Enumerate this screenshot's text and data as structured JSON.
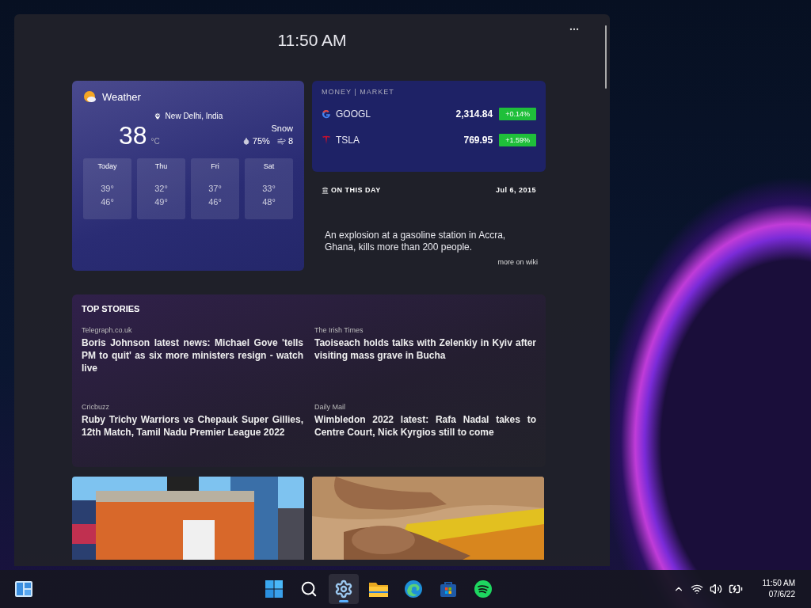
{
  "clock": "11:50 AM",
  "weather": {
    "title": "Weather",
    "location": "New Delhi, India",
    "temperature": "38",
    "unit": "°C",
    "condition": "Snow",
    "humidity": "75%",
    "wind": "8",
    "forecast": [
      {
        "day": "Today",
        "high": "39°",
        "low": "46°"
      },
      {
        "day": "Thu",
        "high": "32°",
        "low": "49°"
      },
      {
        "day": "Fri",
        "high": "37°",
        "low": "46°"
      },
      {
        "day": "Sat",
        "high": "33°",
        "low": "48°"
      }
    ]
  },
  "market": {
    "title": "MONEY | MARKET",
    "stocks": [
      {
        "kind": "g",
        "symbol": "GOOGL",
        "price": "2,314.84",
        "change": "+0.14%"
      },
      {
        "kind": "t",
        "symbol": "TSLA",
        "price": "769.95",
        "change": "+1.59%"
      }
    ]
  },
  "on_this_day": {
    "title": "ON THIS DAY",
    "date": "Jul 6, 2015",
    "text": "An explosion at a gasoline station in Accra, Ghana, kills more than 200 people.",
    "link": "more on wiki"
  },
  "top_stories": {
    "title": "TOP STORIES",
    "stories": [
      {
        "source": "Telegraph.co.uk",
        "headline": "Boris Johnson latest news: Michael Gove 'tells PM to quit' as six more ministers resign - watch live"
      },
      {
        "source": "The Irish Times",
        "headline": "Taoiseach holds talks with Zelenkiy in Kyiv after visiting mass grave in Bucha"
      },
      {
        "source": "Cricbuzz",
        "headline": "Ruby Trichy Warriors vs Chepauk Super Gillies, 12th Match, Tamil Nadu Premier League 2022"
      },
      {
        "source": "Daily Mail",
        "headline": "Wimbledon 2022 latest: Rafa Nadal takes to Centre Court, Nick Kyrgios still to come"
      }
    ]
  },
  "taskbar": {
    "apps": [
      {
        "kind": "start",
        "selected": false
      },
      {
        "kind": "search",
        "selected": false
      },
      {
        "kind": "settings",
        "selected": true
      },
      {
        "kind": "folder",
        "selected": false
      },
      {
        "kind": "browser",
        "selected": false
      },
      {
        "kind": "store",
        "selected": false
      },
      {
        "kind": "music",
        "selected": false
      }
    ],
    "time": "11:50 AM",
    "date": "07/6/22"
  }
}
